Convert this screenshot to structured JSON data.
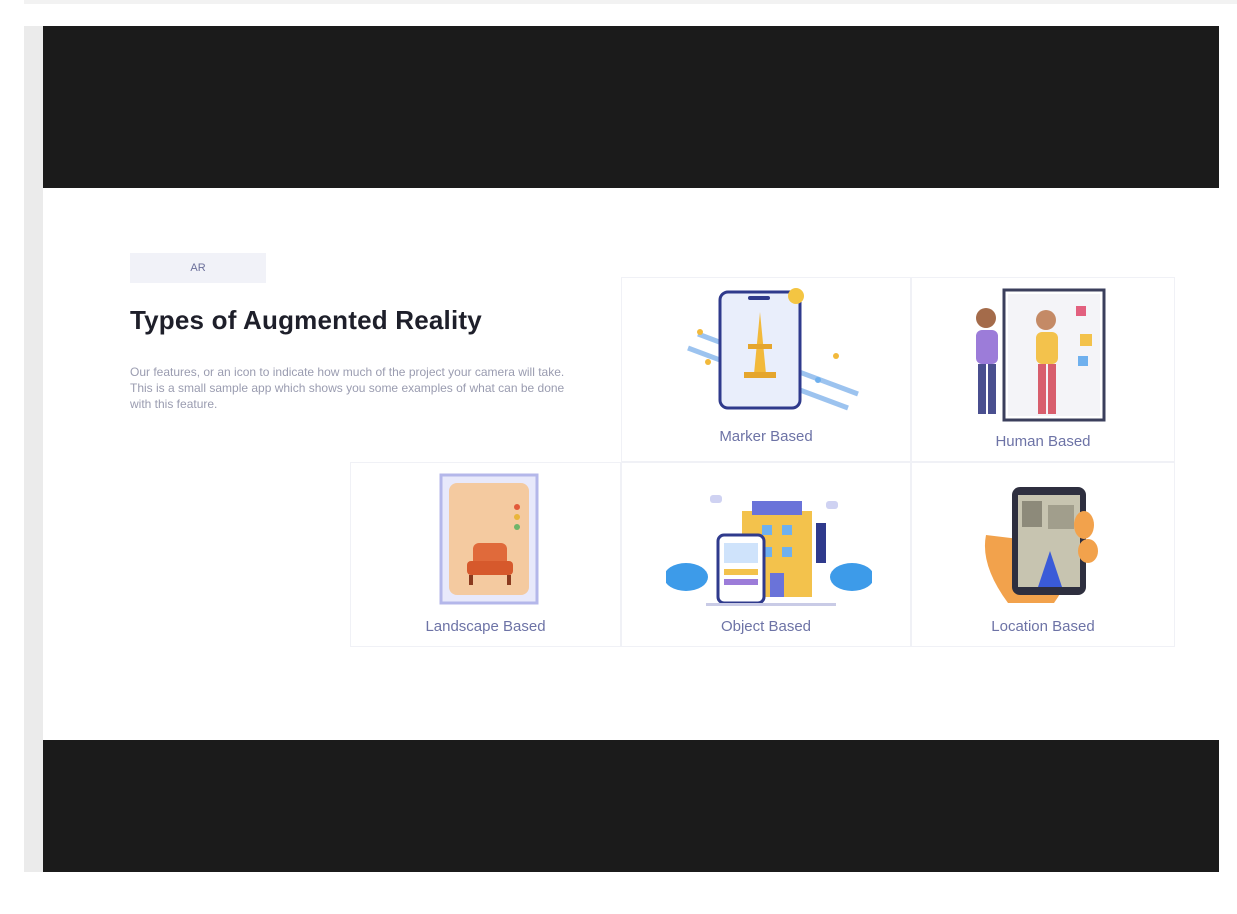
{
  "section": {
    "badge": "AR",
    "title": "Types of Augmented Reality",
    "description": "Our features, or an icon to indicate how much of the project your camera will take. This is a small sample app which shows you some examples of what can be done with this feature."
  },
  "cards": [
    {
      "label": "Marker Based",
      "icon": "phone-eiffel-tower-illustration"
    },
    {
      "label": "Human Based",
      "icon": "people-mirror-illustration"
    },
    {
      "label": "Landscape Based",
      "icon": "armchair-phone-illustration"
    },
    {
      "label": "Object Based",
      "icon": "building-phone-illustration"
    },
    {
      "label": "Location Based",
      "icon": "hand-phone-map-illustration"
    }
  ],
  "colors": {
    "band": "#1b1b1b",
    "accent": "#6d73a6",
    "title": "#1e1f2a",
    "text": "#9a9cb0"
  }
}
